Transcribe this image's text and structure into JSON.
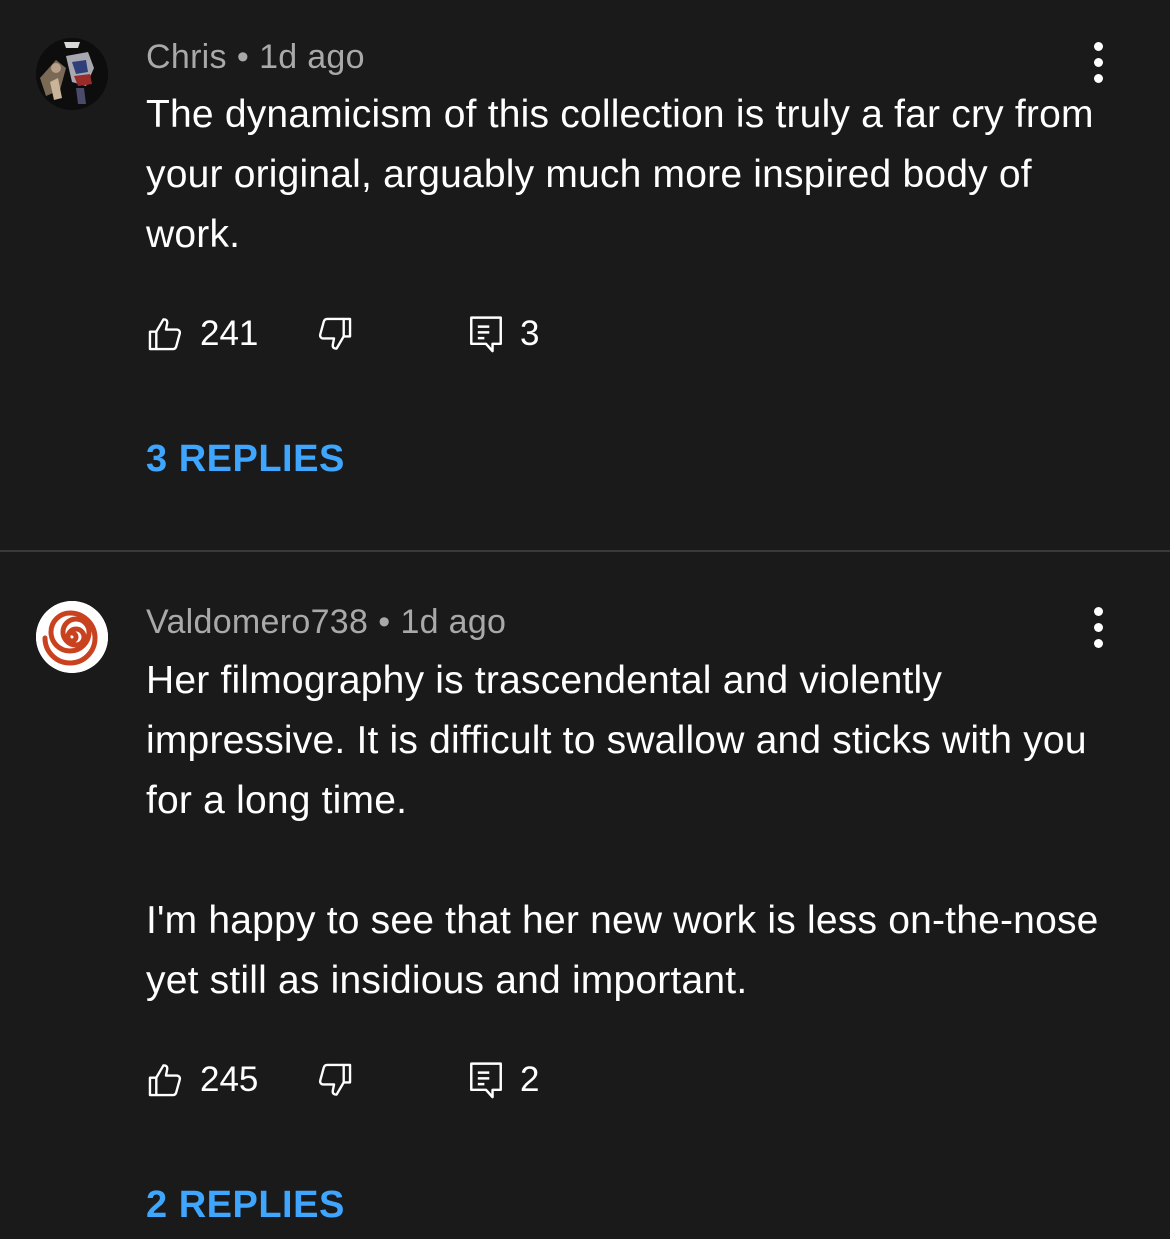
{
  "comments": [
    {
      "author": "Chris",
      "separator": "•",
      "time": "1d ago",
      "text": "The dynamicism of this collection is truly a far cry from your original, arguably much more inspired body of work.",
      "likes": "241",
      "reply_count": "3",
      "replies_label": "3 REPLIES",
      "avatar_icon": "flag-photo-avatar"
    },
    {
      "author": "Valdomero738",
      "separator": "•",
      "time": "1d ago",
      "text": "Her filmography is trascendental and violently impressive. It is difficult to swallow and sticks with you for a long time.\n\nI'm happy to see that her new work is less on-the-nose yet still as insidious and important.",
      "likes": "245",
      "reply_count": "2",
      "replies_label": "2 REPLIES",
      "avatar_icon": "red-spiral-avatar"
    }
  ],
  "colors": {
    "background": "#1a1a1a",
    "text": "#ffffff",
    "meta": "#a9a9a9",
    "link": "#3ea6ff",
    "divider": "#3a3a3a"
  },
  "icons": {
    "like": "thumbs-up-icon",
    "dislike": "thumbs-down-icon",
    "reply": "comment-icon",
    "menu": "more-vertical-icon"
  }
}
